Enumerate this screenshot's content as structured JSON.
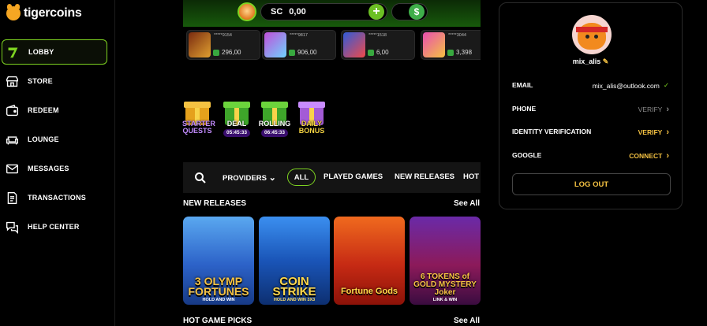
{
  "brand": {
    "name": "tigercoins"
  },
  "sidebar": {
    "items": [
      {
        "label": "LOBBY",
        "icon": "lucky-seven-icon"
      },
      {
        "label": "STORE",
        "icon": "store-icon"
      },
      {
        "label": "REDEEM",
        "icon": "wallet-icon"
      },
      {
        "label": "LOUNGE",
        "icon": "sofa-icon"
      },
      {
        "label": "MESSAGES",
        "icon": "envelope-icon"
      },
      {
        "label": "TRANSACTIONS",
        "icon": "receipt-icon"
      },
      {
        "label": "HELP CENTER",
        "icon": "chat-help-icon"
      }
    ]
  },
  "topbar": {
    "currency": "SC",
    "balance": "0,00",
    "add_symbol": "+",
    "cash_symbol": "$"
  },
  "winners": [
    {
      "name": "*****9154",
      "amount": "296,00"
    },
    {
      "name": "*****9817",
      "amount": "906,00"
    },
    {
      "name": "*****1518",
      "amount": "6,00"
    },
    {
      "name": "*****3044",
      "amount": "3,398"
    }
  ],
  "promos": [
    {
      "label": "STARTER QUESTS",
      "timer": ""
    },
    {
      "label": "DEAL",
      "timer": "05:45:33"
    },
    {
      "label": "ROLLING",
      "timer": "06:45:33"
    },
    {
      "label": "DAILY BONUS",
      "timer": ""
    }
  ],
  "filters": {
    "providers": "PROVIDERS",
    "all": "ALL",
    "played": "PLAYED GAMES",
    "new_releases": "NEW RELEASES",
    "hot": "HOT"
  },
  "sections": {
    "new_releases": "NEW RELEASES",
    "hot_picks": "HOT GAME PICKS",
    "see_all": "See All"
  },
  "games": [
    {
      "title": "3 OLYMP FORTUNES",
      "sub": "HOLD AND WIN"
    },
    {
      "title": "COIN STRIKE",
      "sub": "HOLD AND WIN 3X3"
    },
    {
      "title": "Fortune Gods",
      "sub": ""
    },
    {
      "title": "6 TOKENS of GOLD MYSTERY Joker",
      "sub": "LINK & WIN"
    }
  ],
  "profile": {
    "username": "mix_alis",
    "rows": [
      {
        "label": "EMAIL",
        "value": "mix_alis@outlook.com"
      },
      {
        "label": "PHONE",
        "value": "VERIFY"
      },
      {
        "label": "IDENTITY VERIFICATION",
        "value": "VERIFY"
      },
      {
        "label": "GOOGLE",
        "value": "CONNECT"
      }
    ],
    "logout": "LOG OUT"
  },
  "colors": {
    "accent_green": "#7ed321",
    "gold": "#f5c242",
    "muted": "#8a8a8a",
    "purple": "#3a0e6e"
  }
}
